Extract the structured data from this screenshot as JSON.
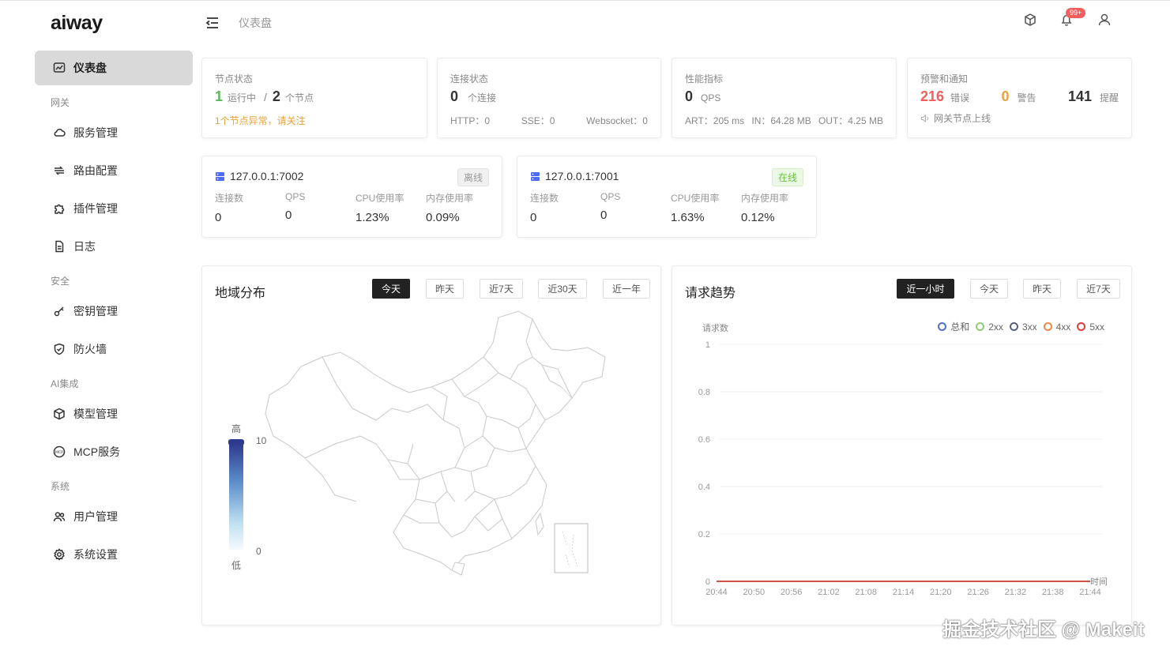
{
  "app": {
    "logo": "aiway"
  },
  "sidebar": {
    "dashboard": "仪表盘",
    "groups": {
      "gateway": "网关",
      "security": "安全",
      "ai": "AI集成",
      "system": "系统"
    },
    "items": {
      "service": "服务管理",
      "route": "路由配置",
      "plugin": "插件管理",
      "log": "日志",
      "keys": "密钥管理",
      "firewall": "防火墙",
      "models": "模型管理",
      "mcp": "MCP服务",
      "users": "用户管理",
      "settings": "系统设置"
    }
  },
  "header": {
    "breadcrumb": "仪表盘",
    "notification_count": "99+"
  },
  "cards": {
    "node": {
      "title": "节点状态",
      "running": "1",
      "running_label": "运行中",
      "sep": "/",
      "total": "2",
      "total_label": "个节点",
      "warning": "1个节点异常，请关注"
    },
    "connection": {
      "title": "连接状态",
      "count": "0",
      "count_label": "个连接",
      "http": "HTTP：0",
      "sse": "SSE：0",
      "websocket": "Websocket：0"
    },
    "performance": {
      "title": "性能指标",
      "qps": "0",
      "qps_label": "QPS",
      "art": "ART：205 ms",
      "in": "IN：64.28 MB",
      "out": "OUT：4.25 MB"
    },
    "alerts": {
      "title": "预警和通知",
      "errors": "216",
      "errors_label": "错误",
      "warnings": "0",
      "warnings_label": "警告",
      "reminders": "141",
      "reminders_label": "提醒",
      "message": "网关节点上线"
    }
  },
  "nodes": [
    {
      "address": "127.0.0.1:7002",
      "status": "离线",
      "labels": [
        "连接数",
        "QPS",
        "CPU使用率",
        "内存使用率"
      ],
      "values": [
        "0",
        "0",
        "1.23%",
        "0.09%"
      ]
    },
    {
      "address": "127.0.0.1:7001",
      "status": "在线",
      "labels": [
        "连接数",
        "QPS",
        "CPU使用率",
        "内存使用率"
      ],
      "values": [
        "0",
        "0",
        "1.63%",
        "0.12%"
      ]
    }
  ],
  "geo_panel": {
    "title": "地域分布",
    "tabs": [
      "今天",
      "昨天",
      "近7天",
      "近30天",
      "近一年"
    ],
    "selected": "今天",
    "scale": {
      "high": "高",
      "low": "低",
      "max": "10",
      "min": "0"
    }
  },
  "trend_panel": {
    "title": "请求趋势",
    "tabs": [
      "近一小时",
      "今天",
      "昨天",
      "近7天"
    ],
    "selected": "近一小时"
  },
  "chart_data": {
    "type": "line",
    "ylabel": "请求数",
    "xlabel": "时间",
    "ylim": [
      0,
      1
    ],
    "yticks": [
      "1",
      "0.8",
      "0.6",
      "0.4",
      "0.2",
      "0"
    ],
    "x": [
      "20:44",
      "20:50",
      "20:56",
      "21:02",
      "21:08",
      "21:14",
      "21:20",
      "21:26",
      "21:32",
      "21:38",
      "21:44"
    ],
    "series": [
      {
        "name": "总和",
        "color": "#5470c6",
        "values": [
          0,
          0,
          0,
          0,
          0,
          0,
          0,
          0,
          0,
          0,
          0
        ]
      },
      {
        "name": "2xx",
        "color": "#91cc75",
        "values": [
          0,
          0,
          0,
          0,
          0,
          0,
          0,
          0,
          0,
          0,
          0
        ]
      },
      {
        "name": "3xx",
        "color": "#5a5f7a",
        "values": [
          0,
          0,
          0,
          0,
          0,
          0,
          0,
          0,
          0,
          0,
          0
        ]
      },
      {
        "name": "4xx",
        "color": "#f08a4b",
        "values": [
          0,
          0,
          0,
          0,
          0,
          0,
          0,
          0,
          0,
          0,
          0
        ]
      },
      {
        "name": "5xx",
        "color": "#e03c3c",
        "values": [
          0,
          0,
          0,
          0,
          0,
          0,
          0,
          0,
          0,
          0,
          0
        ]
      }
    ],
    "legend": "top-right",
    "grid": true
  },
  "watermark": "掘金技术社区 @ Makeit"
}
